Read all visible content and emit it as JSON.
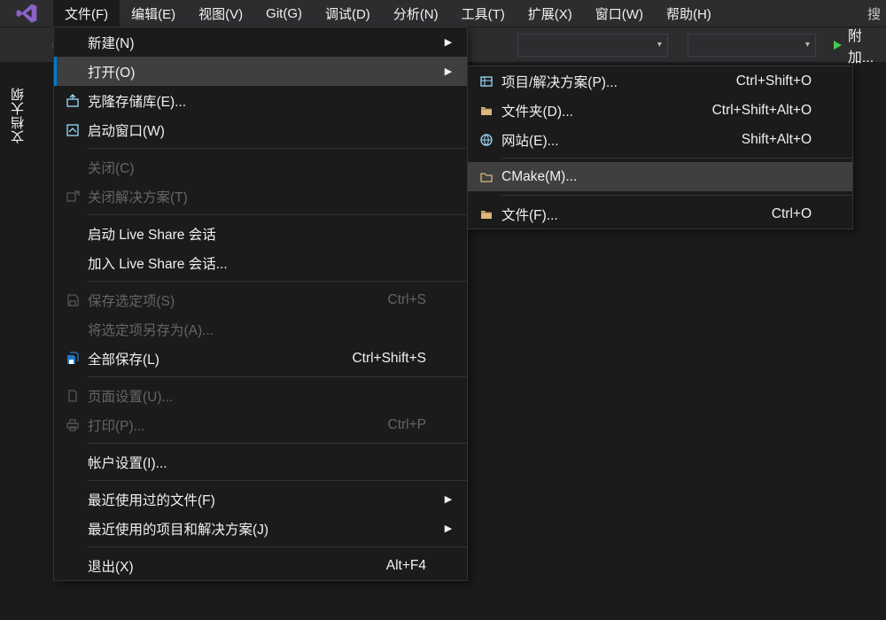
{
  "menubar": {
    "items": [
      "文件(F)",
      "编辑(E)",
      "视图(V)",
      "Git(G)",
      "调试(D)",
      "分析(N)",
      "工具(T)",
      "扩展(X)",
      "窗口(W)",
      "帮助(H)"
    ],
    "search_truncated": "搜"
  },
  "toolbar": {
    "attach_label": "附加..."
  },
  "sidetab": {
    "label": "文档大纲"
  },
  "file_menu": {
    "items": [
      {
        "icon": "",
        "label": "新建(N)",
        "shortcut": "",
        "arrow": true,
        "disabled": false
      },
      {
        "icon": "",
        "label": "打开(O)",
        "shortcut": "",
        "arrow": true,
        "disabled": false,
        "hover": true
      },
      {
        "icon": "clone",
        "label": "克隆存储库(E)...",
        "shortcut": "",
        "arrow": false,
        "disabled": false
      },
      {
        "icon": "home",
        "label": "启动窗口(W)",
        "shortcut": "",
        "arrow": false,
        "disabled": false
      },
      {
        "sep": true
      },
      {
        "icon": "",
        "label": "关闭(C)",
        "shortcut": "",
        "arrow": false,
        "disabled": true
      },
      {
        "icon": "closesln",
        "label": "关闭解决方案(T)",
        "shortcut": "",
        "arrow": false,
        "disabled": true
      },
      {
        "sep": true
      },
      {
        "icon": "",
        "label": "启动 Live Share 会话",
        "shortcut": "",
        "arrow": false,
        "disabled": false
      },
      {
        "icon": "",
        "label": "加入 Live Share 会话...",
        "shortcut": "",
        "arrow": false,
        "disabled": false
      },
      {
        "sep": true
      },
      {
        "icon": "save",
        "label": "保存选定项(S)",
        "shortcut": "Ctrl+S",
        "arrow": false,
        "disabled": true
      },
      {
        "icon": "",
        "label": "将选定项另存为(A)...",
        "shortcut": "",
        "arrow": false,
        "disabled": true
      },
      {
        "icon": "saveall",
        "label": "全部保存(L)",
        "shortcut": "Ctrl+Shift+S",
        "arrow": false,
        "disabled": false
      },
      {
        "sep": true
      },
      {
        "icon": "page",
        "label": "页面设置(U)...",
        "shortcut": "",
        "arrow": false,
        "disabled": true
      },
      {
        "icon": "print",
        "label": "打印(P)...",
        "shortcut": "Ctrl+P",
        "arrow": false,
        "disabled": true
      },
      {
        "sep": true
      },
      {
        "icon": "",
        "label": "帐户设置(I)...",
        "shortcut": "",
        "arrow": false,
        "disabled": false
      },
      {
        "sep": true
      },
      {
        "icon": "",
        "label": "最近使用过的文件(F)",
        "shortcut": "",
        "arrow": true,
        "disabled": false
      },
      {
        "icon": "",
        "label": "最近使用的项目和解决方案(J)",
        "shortcut": "",
        "arrow": true,
        "disabled": false
      },
      {
        "sep": true
      },
      {
        "icon": "",
        "label": "退出(X)",
        "shortcut": "Alt+F4",
        "arrow": false,
        "disabled": false
      }
    ]
  },
  "open_submenu": {
    "items": [
      {
        "icon": "proj",
        "label": "项目/解决方案(P)...",
        "shortcut": "Ctrl+Shift+O"
      },
      {
        "icon": "folder",
        "label": "文件夹(D)...",
        "shortcut": "Ctrl+Shift+Alt+O"
      },
      {
        "icon": "web",
        "label": "网站(E)...",
        "shortcut": "Shift+Alt+O"
      },
      {
        "sep": true
      },
      {
        "icon": "folder2",
        "label": "CMake(M)...",
        "shortcut": "",
        "hover": true
      },
      {
        "sep": true
      },
      {
        "icon": "folder",
        "label": "文件(F)...",
        "shortcut": "Ctrl+O"
      }
    ]
  }
}
